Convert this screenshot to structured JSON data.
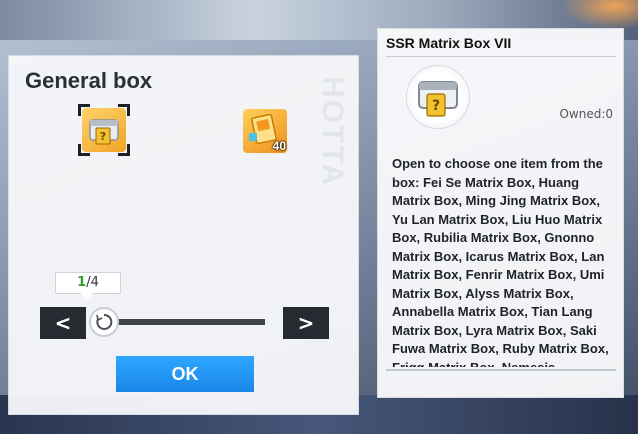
{
  "general_box": {
    "title": "General box",
    "watermark": "HOTTA",
    "items": [
      {
        "name": "matrix-box",
        "icon": "matrix-box-icon",
        "selected": true
      },
      {
        "name": "matrix-pack",
        "icon": "matrix-pack-icon",
        "count": "40",
        "selected": false
      }
    ],
    "quantity": {
      "current": "1",
      "separator": "/",
      "max": "4"
    },
    "prev_label": "<",
    "next_label": ">",
    "ok_label": "OK"
  },
  "detail": {
    "title": "SSR Matrix Box VII",
    "owned": "Owned:0",
    "description": "Open to choose one item from the box: Fei Se Matrix Box, Huang Matrix Box, Ming Jing Matrix Box, Yu Lan Matrix Box, Liu Huo Matrix Box, Rubilia Matrix Box, Gnonno Matrix Box, Icarus Matrix Box, Lan Matrix Box, Fenrir Matrix Box, Umi Matrix Box, Alyss Matrix Box, Annabella Matrix Box, Tian Lang Matrix Box, Lyra Matrix Box, Saki Fuwa Matrix Box, Ruby Matrix Box, Frigg Matrix Box, Nemesis"
  },
  "colors": {
    "ok_button": "#1a86e8",
    "quantity_current": "#2fa12b",
    "item_gold": "#f1a425"
  }
}
